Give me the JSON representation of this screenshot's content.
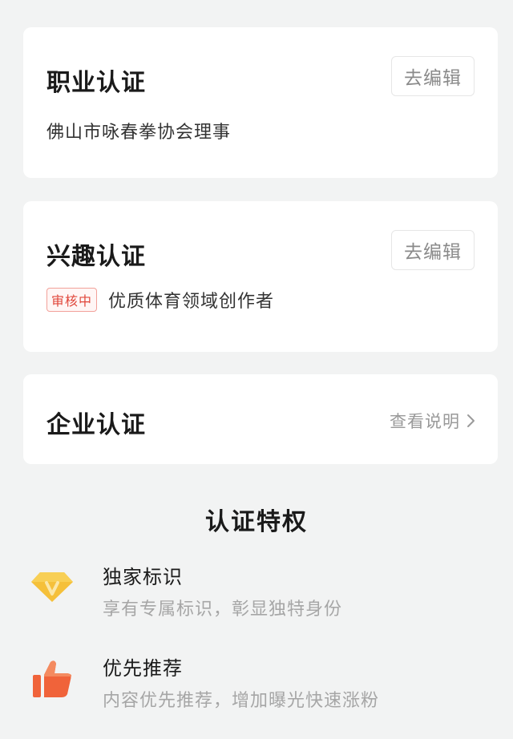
{
  "career_card": {
    "title": "职业认证",
    "edit_label": "去编辑",
    "description": "佛山市咏春拳协会理事"
  },
  "interest_card": {
    "title": "兴趣认证",
    "edit_label": "去编辑",
    "status_badge": "审核中",
    "description": "优质体育领域创作者"
  },
  "enterprise_card": {
    "title": "企业认证",
    "link_label": "查看说明"
  },
  "privileges": {
    "title": "认证特权",
    "items": [
      {
        "icon": "diamond-v-icon",
        "title": "独家标识",
        "subtitle": "享有专属标识，彰显独特身份"
      },
      {
        "icon": "thumbs-up-icon",
        "title": "优先推荐",
        "subtitle": "内容优先推荐，增加曝光快速涨粉"
      }
    ]
  },
  "colors": {
    "background": "#f2f3f3",
    "badge_red": "#e0473b",
    "diamond_gold": "#f5c03a",
    "thumb_orange": "#f0633a"
  }
}
